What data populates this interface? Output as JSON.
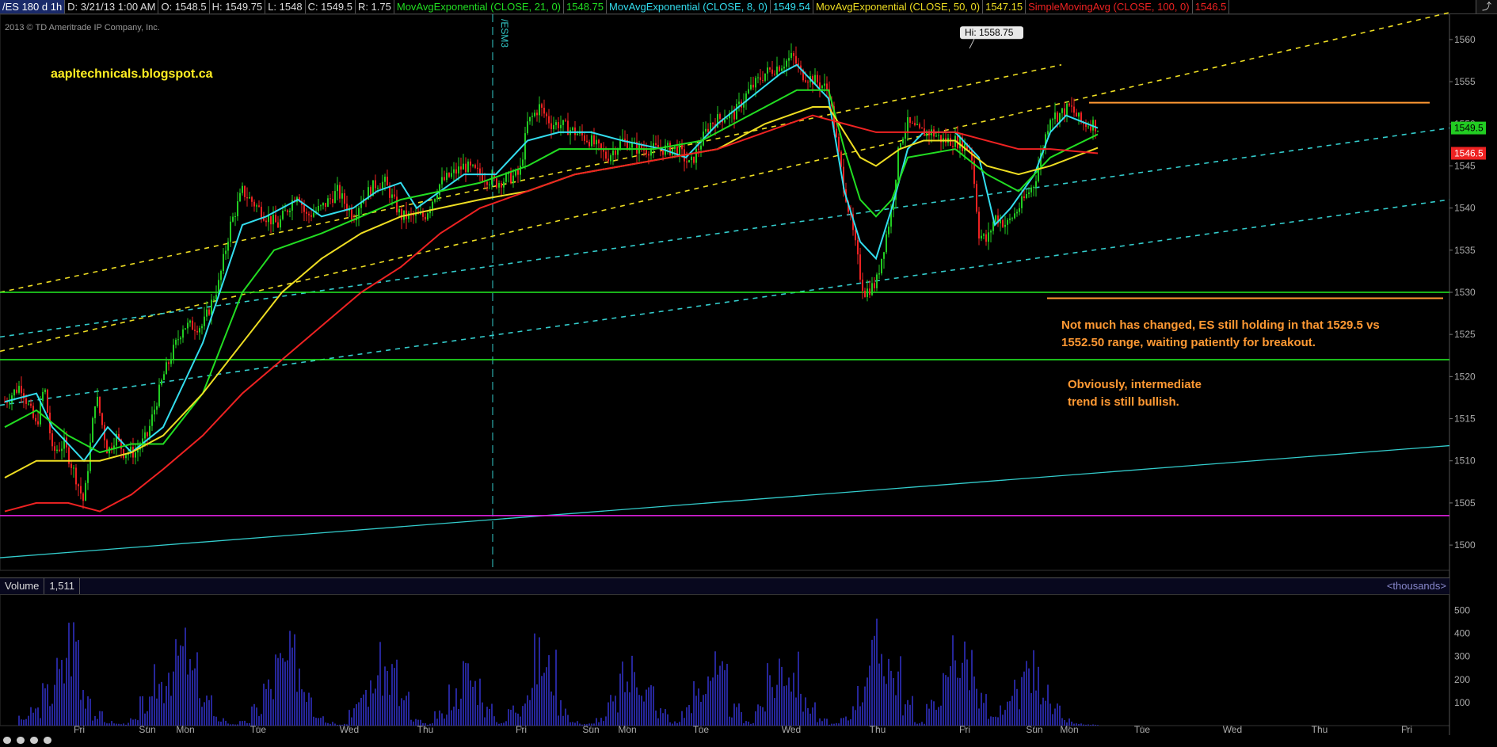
{
  "header": {
    "symbol": "/ES 180 d 1h",
    "date": "D: 3/21/13 1:00 AM",
    "open": "O: 1548.5",
    "high": "H: 1549.75",
    "low": "L: 1548",
    "close": "C: 1549.5",
    "range": "R: 1.75",
    "studies": [
      {
        "label": "MovAvgExponential (CLOSE, 21, 0)",
        "value": "1548.75",
        "color": "#22dd22"
      },
      {
        "label": "MovAvgExponential (CLOSE, 8, 0)",
        "value": "1549.54",
        "color": "#33ddee"
      },
      {
        "label": "MovAvgExponential (CLOSE, 50, 0)",
        "value": "1547.15",
        "color": "#eedd22"
      },
      {
        "label": "SimpleMovingAvg (CLOSE, 100, 0)",
        "value": "1546.5",
        "color": "#ee2222"
      }
    ]
  },
  "copyright": "2013 © TD Ameritrade IP Company, Inc.",
  "watermark": "aapltechnicals.blogspot.ca",
  "contract_marker": "/ESM3",
  "high_label": "Hi: 1558.75",
  "annotations": {
    "note1_line1": "Not much has changed, ES still holding in that 1529.5 vs",
    "note1_line2": "1552.50 range, waiting patiently for breakout.",
    "note2_line1": "Obviously, intermediate",
    "note2_line2": "trend is still bullish."
  },
  "price_badges": [
    {
      "text": "1549.5",
      "color": "#22cc22",
      "price": 1549.5
    },
    {
      "text": "1546.5",
      "color": "#ee2222",
      "price": 1546.5
    }
  ],
  "volume_header": {
    "label": "Volume",
    "value": "1,511",
    "units": "<thousands>"
  },
  "colors": {
    "bull": "#22cc22",
    "bear": "#ee2222",
    "ema8": "#33ddee",
    "ema21": "#22dd22",
    "ema50": "#eedd22",
    "sma100": "#ee2222",
    "volume": "#3a3aee"
  },
  "chart_data": {
    "type": "line",
    "x_ticks": [
      "Fri",
      "Sun",
      "Mon",
      "Tue",
      "Wed",
      "Thu",
      "Fri",
      "Sun",
      "Mon",
      "Tue",
      "Wed",
      "Thu",
      "Fri",
      "Sun",
      "Mon",
      "Tue",
      "Wed",
      "Thu",
      "Fri"
    ],
    "price_ticks": [
      1500,
      1505,
      1510,
      1515,
      1520,
      1525,
      1530,
      1535,
      1540,
      1545,
      1550,
      1555,
      1560
    ],
    "ylim": [
      1497,
      1563
    ],
    "volume_ticks": [
      "100",
      "200",
      "300",
      "400",
      "500"
    ],
    "volume_ylim": [
      0,
      550
    ],
    "close_path_x": [
      0,
      20,
      40,
      50,
      60,
      75,
      90,
      100,
      115,
      130,
      140,
      150,
      165,
      180,
      200,
      225,
      250,
      270,
      285,
      300,
      330,
      345,
      370,
      380,
      400,
      420,
      440,
      450,
      470,
      480,
      500,
      530,
      550,
      580,
      600,
      620,
      650,
      660,
      675,
      690,
      700,
      720,
      740,
      760,
      780,
      800,
      830,
      850,
      865,
      890,
      910,
      920,
      940,
      960,
      980,
      995,
      1005,
      1025,
      1040,
      1055,
      1065,
      1075,
      1080,
      1085,
      1100,
      1120,
      1130,
      1140,
      1155,
      1170,
      1185,
      1200,
      1220,
      1230,
      1240,
      1250,
      1265,
      1280,
      1300,
      1310,
      1320,
      1330,
      1345,
      1360,
      1375,
      1380
    ],
    "close_path": [
      1517,
      1519,
      1514,
      1519,
      1511,
      1512,
      1508,
      1505,
      1518,
      1511,
      1513,
      1511,
      1511,
      1513,
      1520,
      1526,
      1526,
      1531,
      1538,
      1542,
      1539,
      1538,
      1542,
      1539,
      1540,
      1542,
      1539,
      1541,
      1543,
      1543,
      1539,
      1539,
      1543,
      1545,
      1544,
      1543,
      1544,
      1550,
      1552,
      1550,
      1550,
      1549,
      1548,
      1546,
      1548,
      1547,
      1547,
      1547,
      1545,
      1550,
      1551,
      1551,
      1554,
      1556,
      1557,
      1558,
      1556,
      1555,
      1554,
      1545,
      1540,
      1535,
      1532,
      1530,
      1531,
      1540,
      1548,
      1550,
      1549,
      1549,
      1548,
      1548,
      1547,
      1537,
      1536,
      1539,
      1538,
      1540,
      1543,
      1547,
      1551,
      1551,
      1552,
      1550,
      1550,
      1549.5
    ],
    "series": [
      {
        "name": "MovAvgExponential (CLOSE, 8, 0)",
        "x": [
          0,
          40,
          60,
          100,
          130,
          160,
          200,
          250,
          300,
          330,
          370,
          400,
          440,
          470,
          500,
          520,
          550,
          580,
          620,
          660,
          700,
          740,
          780,
          830,
          860,
          900,
          940,
          980,
          1000,
          1020,
          1040,
          1060,
          1080,
          1100,
          1120,
          1140,
          1160,
          1200,
          1230,
          1250,
          1270,
          1300,
          1320,
          1340,
          1380
        ],
        "values": [
          1517,
          1518,
          1514,
          1510,
          1514,
          1511,
          1514,
          1524,
          1538,
          1539,
          1541,
          1539,
          1540,
          1542,
          1543,
          1540,
          1542,
          1544,
          1544,
          1548,
          1549,
          1549,
          1548,
          1547,
          1546,
          1550,
          1553,
          1556,
          1557,
          1555,
          1553,
          1542,
          1536,
          1534,
          1540,
          1547,
          1549,
          1549,
          1546,
          1538,
          1540,
          1544,
          1549,
          1551,
          1549.5
        ]
      },
      {
        "name": "MovAvgExponential (CLOSE, 21, 0)",
        "x": [
          0,
          40,
          80,
          120,
          160,
          200,
          250,
          300,
          340,
          400,
          450,
          500,
          550,
          600,
          660,
          700,
          760,
          820,
          880,
          940,
          1000,
          1040,
          1060,
          1080,
          1100,
          1120,
          1140,
          1200,
          1240,
          1280,
          1320,
          1380
        ],
        "values": [
          1514,
          1516,
          1513,
          1511,
          1512,
          1512,
          1518,
          1530,
          1535,
          1537,
          1539,
          1541,
          1542,
          1543,
          1545,
          1547,
          1547,
          1547,
          1548,
          1551,
          1554,
          1554,
          1547,
          1541,
          1539,
          1541,
          1546,
          1547,
          1544,
          1542,
          1546,
          1548.75
        ]
      },
      {
        "name": "MovAvgExponential (CLOSE, 50, 0)",
        "x": [
          0,
          40,
          80,
          120,
          160,
          200,
          250,
          300,
          350,
          400,
          450,
          500,
          550,
          600,
          660,
          720,
          780,
          840,
          900,
          960,
          1020,
          1040,
          1060,
          1080,
          1100,
          1130,
          1160,
          1200,
          1240,
          1280,
          1320,
          1380
        ],
        "values": [
          1508,
          1510,
          1510,
          1510,
          1511,
          1513,
          1518,
          1524,
          1530,
          1534,
          1537,
          1539,
          1540,
          1541,
          1542,
          1544,
          1545,
          1546,
          1547,
          1550,
          1552,
          1552,
          1549,
          1546,
          1545,
          1547,
          1548,
          1548,
          1545,
          1544,
          1545,
          1547.15
        ]
      },
      {
        "name": "SimpleMovingAvg (CLOSE, 100, 0)",
        "x": [
          0,
          40,
          80,
          120,
          160,
          200,
          250,
          300,
          350,
          400,
          450,
          500,
          550,
          600,
          660,
          720,
          780,
          840,
          900,
          960,
          1020,
          1060,
          1100,
          1140,
          1200,
          1240,
          1280,
          1320,
          1380
        ],
        "values": [
          1504,
          1505,
          1505,
          1504,
          1506,
          1509,
          1513,
          1518,
          1522,
          1526,
          1530,
          1533,
          1537,
          1540,
          1542,
          1544,
          1545,
          1546,
          1547,
          1549,
          1551,
          1550,
          1549,
          1549,
          1549,
          1548,
          1547,
          1547,
          1546.5
        ]
      }
    ],
    "volume_profile": [
      0,
      40,
      90,
      180,
      300,
      500,
      200,
      60,
      20,
      10,
      30,
      120,
      250,
      350,
      420,
      300,
      150,
      40,
      10,
      20,
      90,
      220,
      340,
      380,
      250,
      80,
      20,
      10,
      100,
      200,
      330,
      300,
      150,
      30,
      10,
      60,
      180,
      300,
      240,
      90,
      20,
      100,
      220,
      380,
      320,
      120,
      20,
      10,
      40,
      130,
      260,
      320,
      200,
      80,
      20,
      90,
      210,
      320,
      260,
      90,
      20,
      120,
      250,
      360,
      300,
      120,
      30,
      10,
      40,
      180,
      380,
      440,
      300,
      120,
      20,
      110,
      230,
      440,
      380,
      150,
      40,
      100,
      200,
      320,
      260,
      90,
      30,
      10,
      5,
      3
    ]
  }
}
